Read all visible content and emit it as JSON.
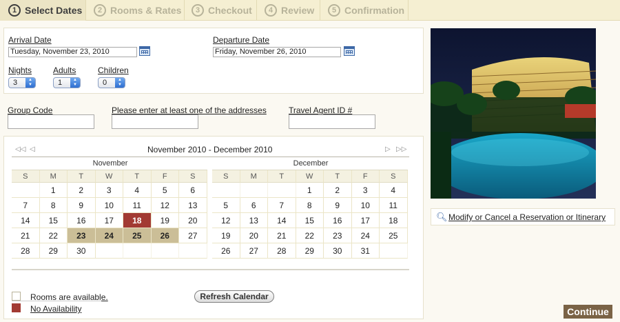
{
  "steps": [
    {
      "num": "1",
      "label": "Select Dates"
    },
    {
      "num": "2",
      "label": "Rooms & Rates"
    },
    {
      "num": "3",
      "label": "Checkout"
    },
    {
      "num": "4",
      "label": "Review"
    },
    {
      "num": "5",
      "label": "Confirmation"
    }
  ],
  "form": {
    "arrival_label": "Arrival Date",
    "arrival_value": "Tuesday, November 23, 2010",
    "departure_label": "Departure Date",
    "departure_value": "Friday, November 26, 2010",
    "nights_label": "Nights",
    "nights_value": "3",
    "adults_label": "Adults",
    "adults_value": "1",
    "children_label": "Children",
    "children_value": "0",
    "group_code_label": "Group Code",
    "address_label": "Please enter at least one of the addresses",
    "agent_label": "Travel Agent ID #"
  },
  "calendar": {
    "title": "November 2010 - December 2010",
    "weekdays": [
      "S",
      "M",
      "T",
      "W",
      "T",
      "F",
      "S"
    ],
    "months": [
      {
        "name": "November",
        "weeks": [
          [
            "",
            "1",
            "2",
            "3",
            "4",
            "5",
            "6"
          ],
          [
            "7",
            "8",
            "9",
            "10",
            "11",
            "12",
            "13"
          ],
          [
            "14",
            "15",
            "16",
            "17",
            "18",
            "19",
            "20"
          ],
          [
            "21",
            "22",
            "23",
            "24",
            "25",
            "26",
            "27"
          ],
          [
            "28",
            "29",
            "30",
            "",
            "",
            "",
            ""
          ]
        ]
      },
      {
        "name": "December",
        "weeks": [
          [
            "",
            "",
            "",
            "1",
            "2",
            "3",
            "4"
          ],
          [
            "5",
            "6",
            "7",
            "8",
            "9",
            "10",
            "11"
          ],
          [
            "12",
            "13",
            "14",
            "15",
            "16",
            "17",
            "18"
          ],
          [
            "19",
            "20",
            "21",
            "22",
            "23",
            "24",
            "25"
          ],
          [
            "26",
            "27",
            "28",
            "29",
            "30",
            "31",
            ""
          ]
        ]
      }
    ],
    "selected_days": [
      "23",
      "24",
      "25",
      "26"
    ],
    "today": "18",
    "legend_available": "Rooms are available.",
    "legend_unavailable": "No Availability",
    "refresh_label": "Refresh Calendar"
  },
  "sidebar": {
    "modify_link": "Modify or Cancel a Reservation or Itinerary"
  },
  "continue_label": "Continue",
  "colors": {
    "selected": "#cbbe97",
    "unavailable": "#a23a33",
    "continue": "#7a6346"
  }
}
